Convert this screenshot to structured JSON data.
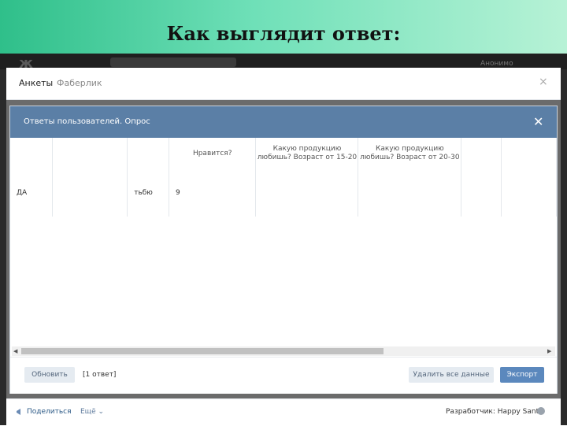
{
  "slide": {
    "title": "Как выглядит ответ:"
  },
  "vk": {
    "logo": "ж",
    "user": "Анонимо"
  },
  "app": {
    "tabs": [
      {
        "label": "Анкеты"
      },
      {
        "label": "Фаберлик"
      }
    ],
    "close_symbol": "×"
  },
  "modal": {
    "title": "Ответы пользователей. Опрос",
    "close_symbol": "✕",
    "table": {
      "headers": [
        "",
        "",
        "",
        "Нравится?",
        "Какую продукцию любишь? Возраст от 15-20",
        "Какую продукцию любишь? Возраст от 20-30",
        "",
        ""
      ],
      "rows": [
        [
          "ДА",
          "",
          "тьбю",
          "9",
          "",
          "",
          "",
          ""
        ]
      ]
    },
    "scrollbar": {
      "left_arrow": "◀",
      "right_arrow": "▶"
    },
    "footer": {
      "refresh_label": "Обновить",
      "count_label": "[1 ответ]",
      "delete_label": "Удалить все данные",
      "export_label": "Экспорт"
    }
  },
  "bottom": {
    "share_label": "Поделиться",
    "more_label": "Ещё ⌄",
    "developer_label": "Разработчик: Happy Santa"
  },
  "icons": {
    "share": "megaphone-icon",
    "developer_avatar": "avatar"
  }
}
